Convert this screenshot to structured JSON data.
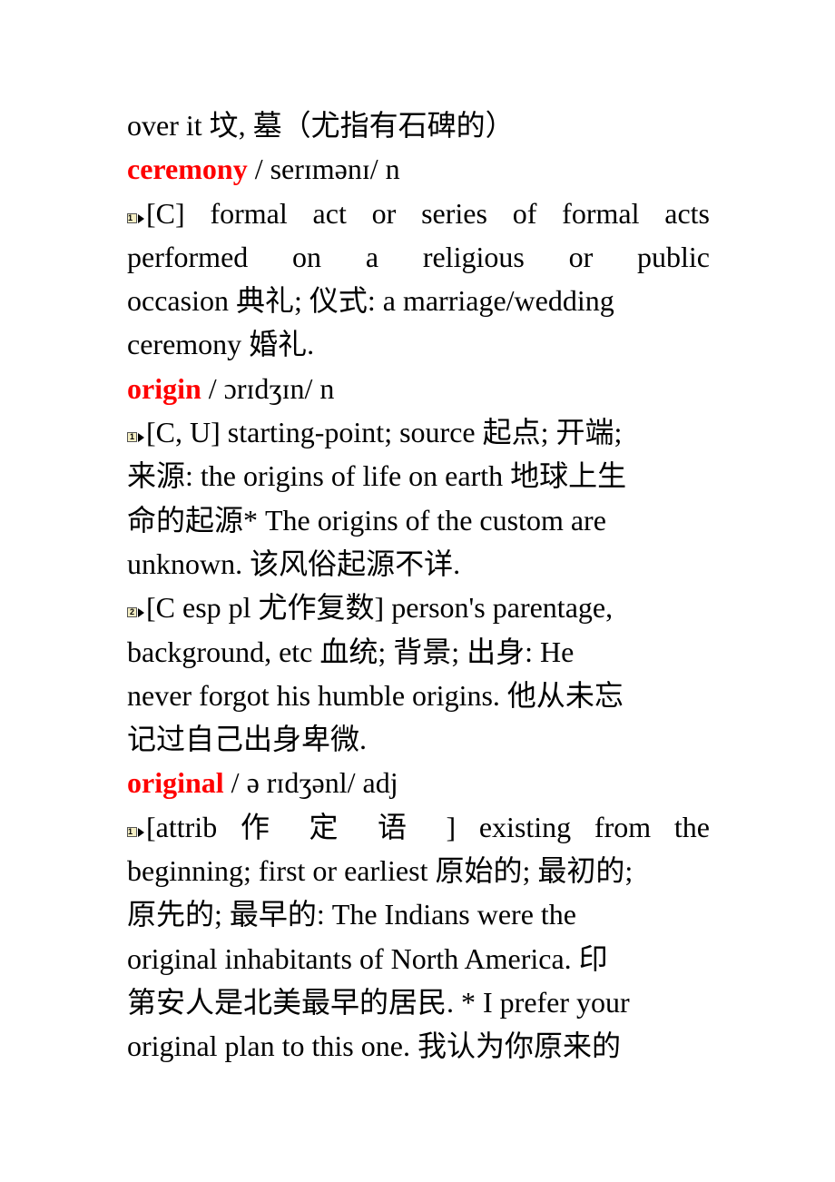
{
  "lines": {
    "l0": "over it  坟, 墓（尤指有石碑的）"
  },
  "entries": [
    {
      "headword": "ceremony",
      "phonetic": " /    serɪmənɪ/ n",
      "senses": [
        {
          "number": "1",
          "lines": [
            "[C]  formal  act  or  series  of  formal  acts",
            "performed  on  a  religious  or  public",
            "occasion  典礼; 仪式: a marriage/wedding",
            "ceremony  婚礼."
          ]
        }
      ]
    },
    {
      "headword": "origin",
      "phonetic": " /    ɔrɪdʒɪn/ n",
      "senses": [
        {
          "number": "1",
          "lines": [
            "[C, U] starting-point; source  起点;  开端;",
            "来源: the origins of life on earth  地球上生",
            "命的起源* The origins of the custom are",
            "unknown.  该风俗起源不详."
          ]
        },
        {
          "number": "2",
          "lines": [
            "[C esp pl  尤作复数] person's parentage,",
            "background, etc  血统;  背景;  出身: He",
            "never forgot his humble origins.  他从未忘",
            "记过自己出身卑微."
          ]
        }
      ]
    },
    {
      "headword": "original",
      "phonetic": " /  ə    rɪdʒənl/ adj",
      "senses": [
        {
          "number": "1",
          "lines": [
            "[attrib   作  定  语  ]  existing  from  the",
            "beginning; first or earliest  原始的;  最初的;",
            "原先的;  最早的: The Indians were the",
            "original inhabitants of North America.  印",
            "第安人是北美最早的居民. * I prefer your",
            "original plan to this one.  我认为你原来的"
          ]
        }
      ]
    }
  ],
  "icons": {
    "sense_marker": "numbered-arrow-icon"
  },
  "colors": {
    "headword": "#ff0000",
    "text": "#000000",
    "icon_fill": "#f5efc4"
  }
}
